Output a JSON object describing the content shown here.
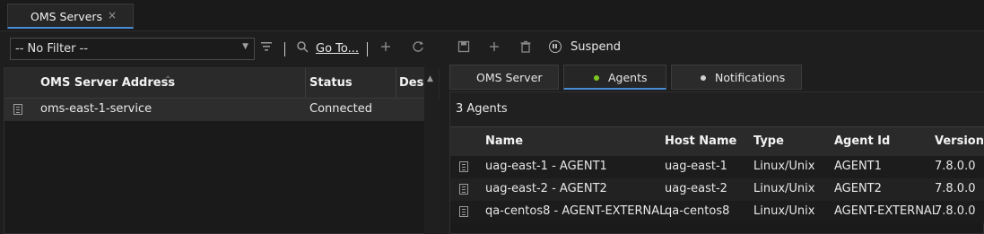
{
  "tabs": {
    "active_tab_label": "OMS Servers",
    "close_glyph": "×"
  },
  "left_toolbar": {
    "filter_value": "-- No Filter --",
    "goto_label": "Go To...",
    "icons": [
      "chevron-down-icon",
      "filter-icon",
      "search-icon",
      "add-icon",
      "refresh-icon"
    ]
  },
  "left_grid": {
    "columns": [
      "OMS Server Address",
      "Status",
      "Desc"
    ],
    "rows": [
      {
        "address": "oms-east-1-service",
        "status": "Connected"
      }
    ]
  },
  "right_toolbar": {
    "suspend_label": "Suspend",
    "icons": [
      "save-icon",
      "add-icon",
      "delete-icon",
      "pause-circle-icon"
    ]
  },
  "right_tabs": [
    {
      "label": "OMS Server",
      "dot_color": null
    },
    {
      "label": "Agents",
      "dot_color": "#7ec820"
    },
    {
      "label": "Notifications",
      "dot_color": "#d0d0d0"
    }
  ],
  "agents": {
    "count_label": "3 Agents",
    "columns": [
      "Name",
      "Host Name",
      "Type",
      "Agent Id",
      "Version"
    ],
    "rows": [
      {
        "name": "uag-east-1 - AGENT1",
        "host": "uag-east-1",
        "type": "Linux/Unix",
        "agent_id": "AGENT1",
        "version": "7.8.0.0"
      },
      {
        "name": "uag-east-2 - AGENT2",
        "host": "uag-east-2",
        "type": "Linux/Unix",
        "agent_id": "AGENT2",
        "version": "7.8.0.0"
      },
      {
        "name": "qa-centos8 - AGENT-EXTERNAL",
        "host": "qa-centos8",
        "type": "Linux/Unix",
        "agent_id": "AGENT-EXTERNAL",
        "version": "7.8.0.0"
      }
    ]
  },
  "colors": {
    "accent": "#4a8bd6",
    "background": "#1e1e1e",
    "selected_row": "#2d2d2d"
  }
}
